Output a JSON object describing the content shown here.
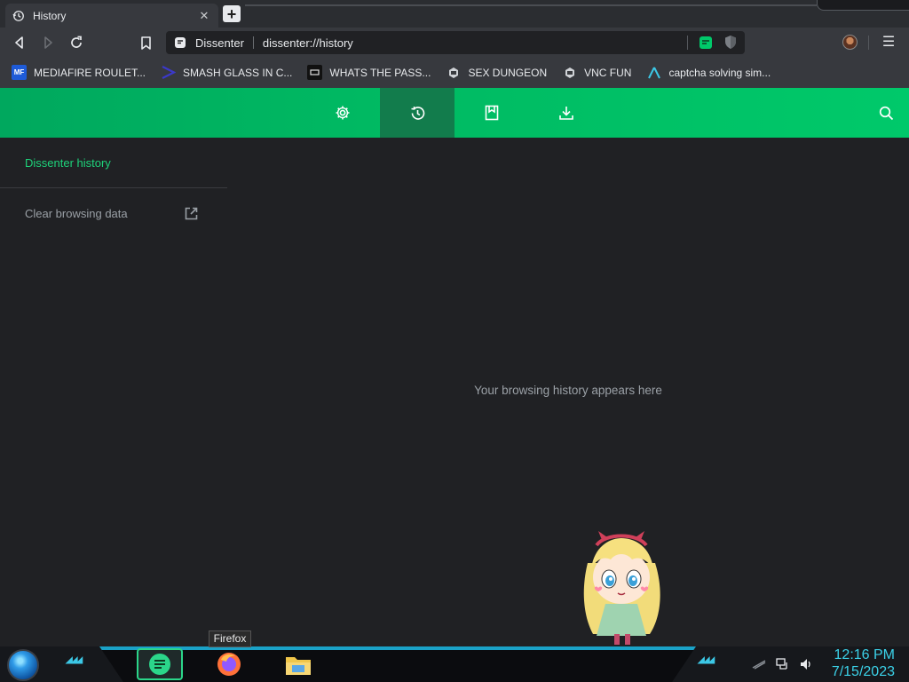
{
  "tab": {
    "title": "History",
    "close_glyph": "✕",
    "newtab_glyph": "+"
  },
  "address_bar": {
    "site_label": "Dissenter",
    "url": "dissenter://history"
  },
  "toolbar": {
    "menu_glyph": "☰"
  },
  "bookmarks": [
    {
      "label": "MEDIAFIRE ROULET...",
      "icon": "mediafire-icon",
      "color": "#1e5bd8"
    },
    {
      "label": "SMASH GLASS IN C...",
      "icon": "chevron-bookmark-icon",
      "color": "#3b39c8"
    },
    {
      "label": "WHATS THE PASS...",
      "icon": "page-bookmark-icon",
      "color": "#111111"
    },
    {
      "label": "SEX DUNGEON",
      "icon": "pixel-bookmark-icon",
      "color": "#cfd2d6"
    },
    {
      "label": "VNC FUN",
      "icon": "pixel-bookmark-icon",
      "color": "#cfd2d6"
    },
    {
      "label": "captcha solving sim...",
      "icon": "triangle-bookmark-icon",
      "color": "#3cc8e6"
    }
  ],
  "page_nav": {
    "items": [
      {
        "name": "settings",
        "icon": "gear-icon",
        "active": false
      },
      {
        "name": "history",
        "icon": "history-icon",
        "active": true
      },
      {
        "name": "bookmarks",
        "icon": "bookmark-icon",
        "active": false
      },
      {
        "name": "downloads",
        "icon": "download-icon",
        "active": false
      }
    ],
    "accent": "#00c96a"
  },
  "sidebar": {
    "title": "Dissenter history",
    "clear_label": "Clear browsing data"
  },
  "main": {
    "empty_message": "Your browsing history appears here"
  },
  "taskbar": {
    "tooltip": "Firefox",
    "apps": [
      "dissenter-browser",
      "firefox",
      "file-explorer"
    ],
    "accent": "#1aa2c8"
  },
  "clock": {
    "time": "12:16 PM",
    "date": "7/15/2023"
  }
}
